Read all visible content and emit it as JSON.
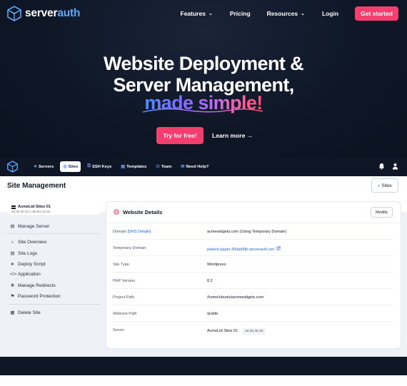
{
  "brand": {
    "part1": "server",
    "part2": "auth"
  },
  "topnav": {
    "features": "Features",
    "pricing": "Pricing",
    "resources": "Resources",
    "login": "Login",
    "cta": "Get started"
  },
  "hero": {
    "line1": "Website Deployment &",
    "line2": "Server Management,",
    "tagline": "made simple!",
    "try_button": "Try for free!",
    "learn_more": "Learn more →"
  },
  "app": {
    "tabs": [
      {
        "label": "Servers",
        "icon": "server-group-icon",
        "glyph": "✶"
      },
      {
        "label": "Sites",
        "icon": "globe-icon",
        "glyph": "◎",
        "active": true
      },
      {
        "label": "SSH Keys",
        "icon": "key-icon",
        "glyph": "⚿"
      },
      {
        "label": "Templates",
        "icon": "layers-icon",
        "glyph": "▤"
      },
      {
        "label": "Team",
        "icon": "team-icon",
        "glyph": "⚇"
      },
      {
        "label": "Need Help?",
        "icon": "chat-icon",
        "glyph": "✉"
      }
    ],
    "page_title": "Site Management",
    "sites_button": "Sites",
    "server": {
      "name": "AcmeLtd Sites 01",
      "sub": "10.20.30.40 | Ubuntu 22.04"
    },
    "sidebar": {
      "manage_server": "Manage Server",
      "items": [
        "Site Overview",
        "Site Logs",
        "Deploy Script",
        "Application",
        "Manage Redirects",
        "Password Protection"
      ],
      "delete_site": "Delete Site"
    },
    "panel": {
      "title": "Website Details",
      "modify": "Modify",
      "rows": [
        {
          "key": "Domain",
          "key_extra": "[DNS Details]",
          "value": "acmewidgets.com (Using Temporary Domain)"
        },
        {
          "key": "Temporary Domain",
          "value": "patient-paper-43dab5fb.serverauth.net",
          "link": true
        },
        {
          "key": "Site Type",
          "value": "Wordpress"
        },
        {
          "key": "PHP Version",
          "value": "8.2"
        },
        {
          "key": "Project Path",
          "value": "/home/ubuntu/acmewidgets.com"
        },
        {
          "key": "Webroot Path",
          "value": "/public"
        },
        {
          "key": "Server",
          "value": "AcmeLtd Sites 01",
          "pill": "10.20.30.40"
        }
      ]
    }
  },
  "colors": {
    "accent": "#f43f6e",
    "brand_blue": "#5aa9ff",
    "dark_bg": "#0f1727",
    "link": "#2563eb"
  }
}
